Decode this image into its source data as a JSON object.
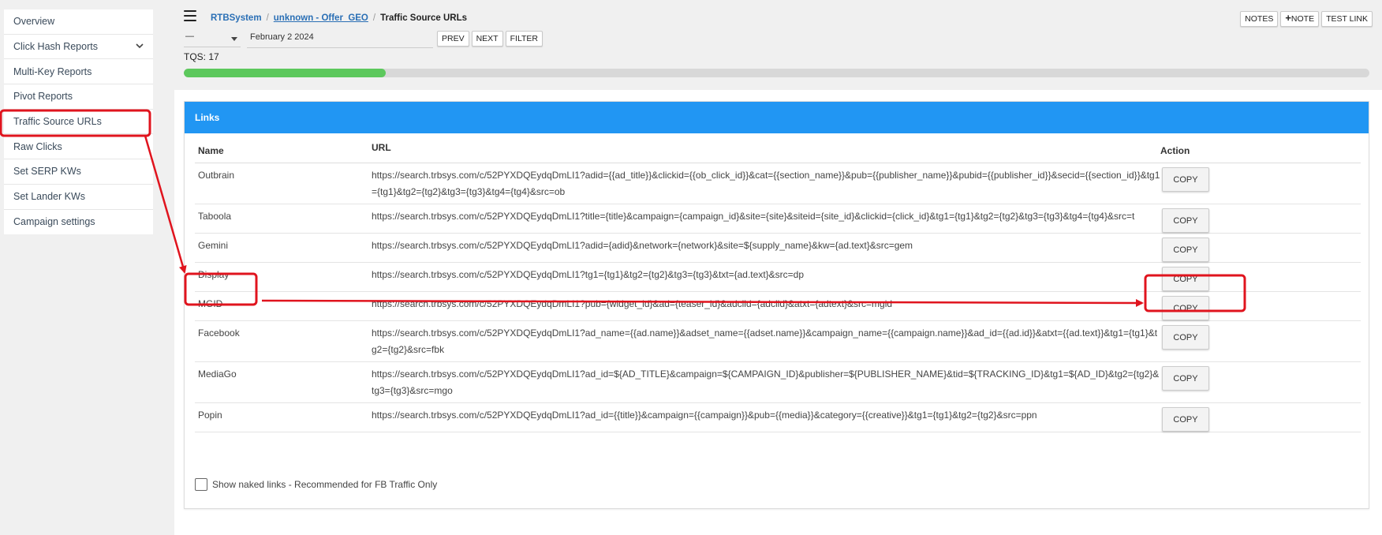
{
  "sidebar": {
    "items": [
      {
        "label": "Overview"
      },
      {
        "label": "Click Hash Reports"
      },
      {
        "label": "Multi-Key Reports"
      },
      {
        "label": "Pivot Reports"
      },
      {
        "label": "Traffic Source URLs"
      },
      {
        "label": "Raw Clicks"
      },
      {
        "label": "Set SERP KWs"
      },
      {
        "label": "Set Lander KWs"
      },
      {
        "label": "Campaign settings"
      }
    ]
  },
  "header": {
    "breadcrumb": [
      "RTBSystem",
      "unknown - Offer_GEO",
      "Traffic Source URLs"
    ],
    "buttons": {
      "notes": "NOTES",
      "note": "NOTE",
      "test_link": "TEST LINK"
    },
    "select_value": "—",
    "date": "February 2 2024",
    "nav": {
      "prev": "PREV",
      "next": "NEXT",
      "filter": "FILTER"
    },
    "tqs": "TQS: 17",
    "progress_fraction": 0.17
  },
  "card": {
    "title": "Links",
    "columns": {
      "name": "Name",
      "url": "URL",
      "action": "Action"
    },
    "rows": [
      {
        "name": "Outbrain",
        "url": "https://search.trbsys.com/c/52PYXDQEydqDmLI1?adid={{ad_title}}&clickid={{ob_click_id}}&cat={{section_name}}&pub={{publisher_name}}&pubid={{publisher_id}}&secid={{section_id}}&tg1={tg1}&tg2={tg2}&tg3={tg3}&tg4={tg4}&src=ob",
        "action": "COPY"
      },
      {
        "name": "Taboola",
        "url": "https://search.trbsys.com/c/52PYXDQEydqDmLI1?title={title}&campaign={campaign_id}&site={site}&siteid={site_id}&clickid={click_id}&tg1={tg1}&tg2={tg2}&tg3={tg3}&tg4={tg4}&src=t",
        "action": "COPY"
      },
      {
        "name": "Gemini",
        "url": "https://search.trbsys.com/c/52PYXDQEydqDmLI1?adid={adid}&network={network}&site=${supply_name}&kw={ad.text}&src=gem",
        "action": "COPY"
      },
      {
        "name": "Display",
        "url": "https://search.trbsys.com/c/52PYXDQEydqDmLI1?tg1={tg1}&tg2={tg2}&tg3={tg3}&txt={ad.text}&src=dp",
        "action": "COPY"
      },
      {
        "name": "MGID",
        "url": "https://search.trbsys.com/c/52PYXDQEydqDmLI1?pub={widget_id}&ad={teaser_id}&adclid={adclid}&atxt={adtext}&src=mgid",
        "action": "COPY"
      },
      {
        "name": "Facebook",
        "url": "https://search.trbsys.com/c/52PYXDQEydqDmLI1?ad_name={{ad.name}}&adset_name={{adset.name}}&campaign_name={{campaign.name}}&ad_id={{ad.id}}&atxt={{ad.text}}&tg1={tg1}&tg2={tg2}&src=fbk",
        "action": "COPY"
      },
      {
        "name": "MediaGo",
        "url": "https://search.trbsys.com/c/52PYXDQEydqDmLI1?ad_id=${AD_TITLE}&campaign=${CAMPAIGN_ID}&publisher=${PUBLISHER_NAME}&tid=${TRACKING_ID}&tg1=${AD_ID}&tg2={tg2}&tg3={tg3}&src=mgo",
        "action": "COPY"
      },
      {
        "name": "Popin",
        "url": "https://search.trbsys.com/c/52PYXDQEydqDmLI1?ad_id={{title}}&campaign={{campaign}}&pub={{media}}&category={{creative}}&tg1={tg1}&tg2={tg2}&src=ppn",
        "action": "COPY"
      }
    ],
    "naked_links_label": "Show naked links - Recommended for FB Traffic Only"
  },
  "colors": {
    "accent": "#2196f3",
    "progress": "#5cc85c",
    "annotation": "#e0141e",
    "link": "#2a6fb5"
  }
}
